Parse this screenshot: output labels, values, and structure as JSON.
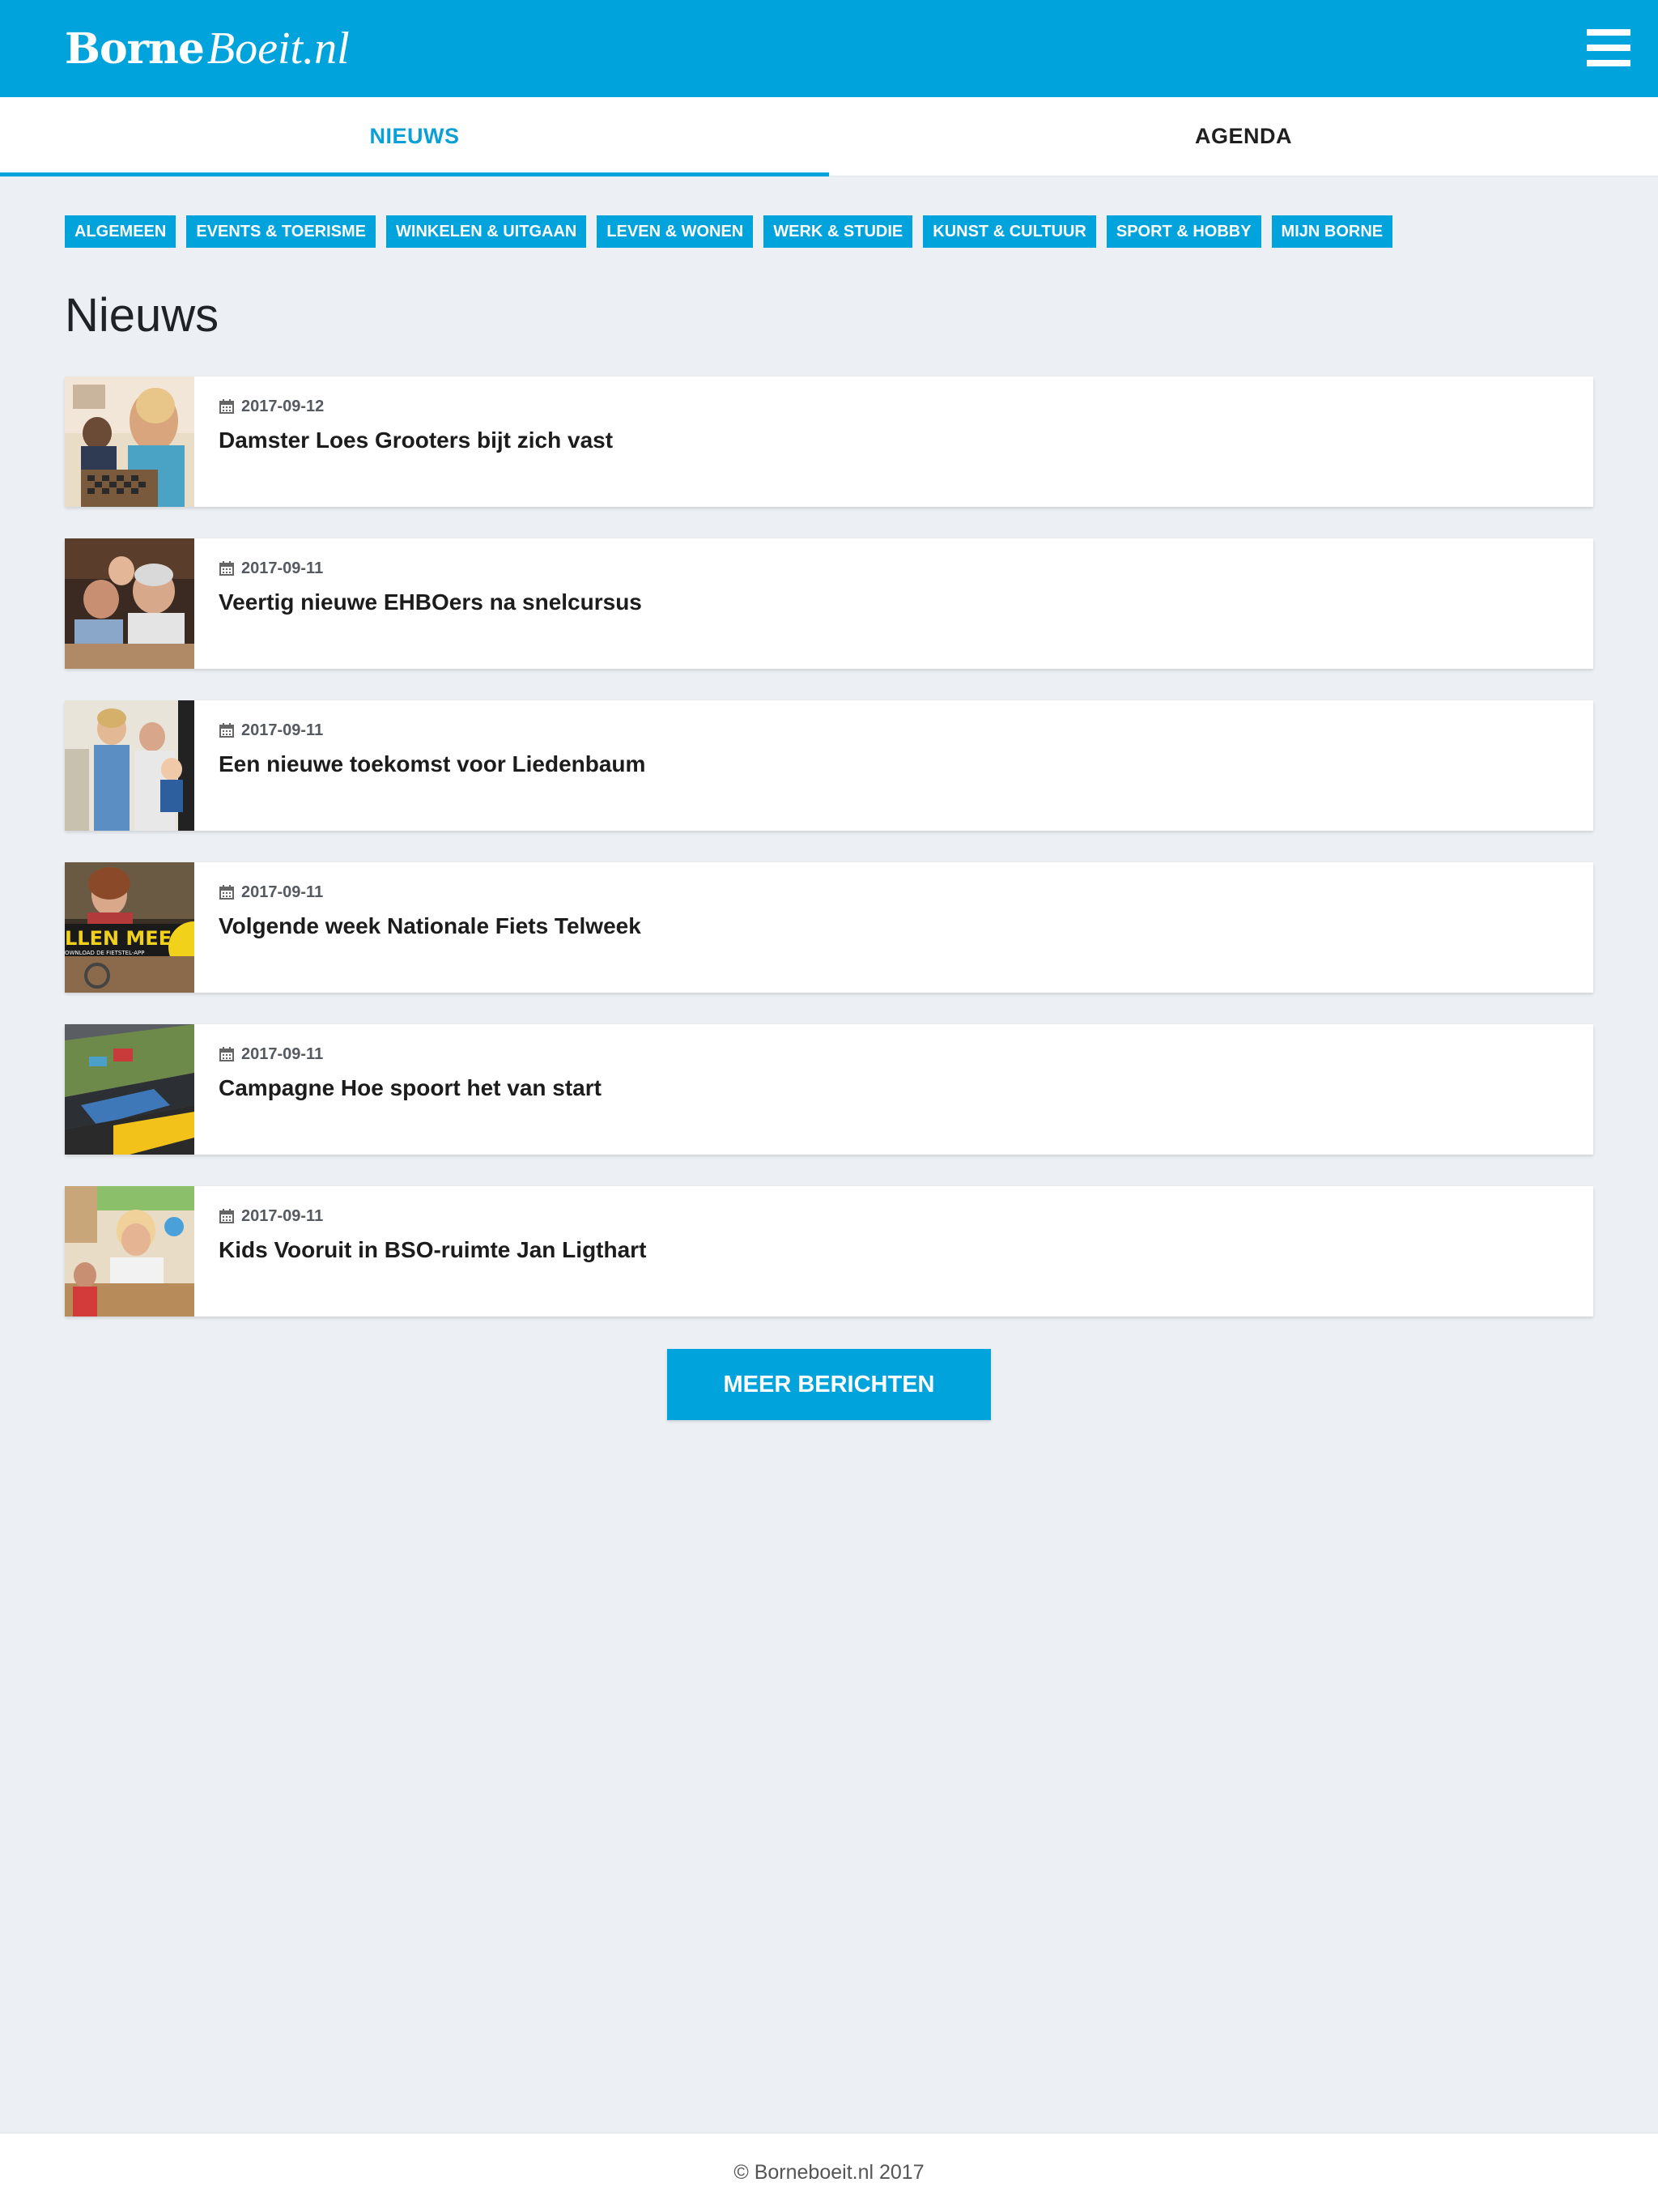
{
  "header": {
    "logo_main": "Borne",
    "logo_script": "Boeit.nl",
    "menu_icon": "hamburger-menu-icon"
  },
  "tabs": [
    {
      "label": "NIEUWS",
      "active": true
    },
    {
      "label": "AGENDA",
      "active": false
    }
  ],
  "categories": [
    "ALGEMEEN",
    "EVENTS & TOERISME",
    "WINKELEN & UITGAAN",
    "LEVEN & WONEN",
    "WERK & STUDIE",
    "KUNST & CULTUUR",
    "SPORT & HOBBY",
    "MIJN BORNE"
  ],
  "main": {
    "title": "Nieuws",
    "news": [
      {
        "date": "2017-09-12",
        "title": "Damster Loes Grooters bijt zich vast",
        "thumb_icon": "photo-checkers-icon"
      },
      {
        "date": "2017-09-11",
        "title": "Veertig nieuwe EHBOers na snelcursus",
        "thumb_icon": "photo-group-icon"
      },
      {
        "date": "2017-09-11",
        "title": "Een nieuwe toekomst voor Liedenbaum",
        "thumb_icon": "photo-family-icon"
      },
      {
        "date": "2017-09-11",
        "title": "Volgende week Nationale Fiets Telweek",
        "thumb_icon": "photo-cycling-icon",
        "thumb_text": "LLEN MEE",
        "thumb_subtext": "OWNLOAD DE FIETSTEL-APP"
      },
      {
        "date": "2017-09-11",
        "title": "Campagne Hoe spoort het van start",
        "thumb_icon": "photo-railway-icon"
      },
      {
        "date": "2017-09-11",
        "title": "Kids Vooruit in BSO-ruimte Jan Ligthart",
        "thumb_icon": "photo-classroom-icon"
      }
    ],
    "more_button": "MEER BERICHTEN"
  },
  "footer": {
    "copyright": "© Borneboeit.nl 2017"
  },
  "colors": {
    "brand": "#00a3db",
    "background": "#ecf0f4",
    "active_tab_text": "#0c9fd6"
  }
}
